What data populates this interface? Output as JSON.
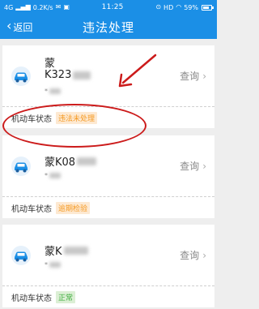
{
  "status_bar": {
    "network": "4G",
    "speed": "0.2K/s",
    "time": "11:25",
    "hd": "HD",
    "battery": "59%"
  },
  "nav": {
    "back_label": "返回",
    "title": "违法处理"
  },
  "vehicles": [
    {
      "plate_line1": "蒙",
      "plate_line2": "K323",
      "owner_prefix": "*",
      "status_label": "机动车状态",
      "status_value": "违法未处理",
      "status_color": "#f59a23",
      "status_bg": "#fde9d2",
      "query_label": "查询"
    },
    {
      "plate_line1": "蒙K08",
      "plate_line2": "",
      "owner_prefix": "*",
      "status_label": "机动车状态",
      "status_value": "逾期检验",
      "status_color": "#f59a23",
      "status_bg": "#fde9d2",
      "query_label": "查询"
    },
    {
      "plate_line1": "蒙K",
      "plate_line2": "",
      "owner_prefix": "*",
      "status_label": "机动车状态",
      "status_value": "正常",
      "status_color": "#3fae3f",
      "status_bg": "#dcefd5",
      "query_label": "查询"
    }
  ],
  "colors": {
    "primary": "#1b8fe6",
    "annotation": "#cc1b1b"
  }
}
